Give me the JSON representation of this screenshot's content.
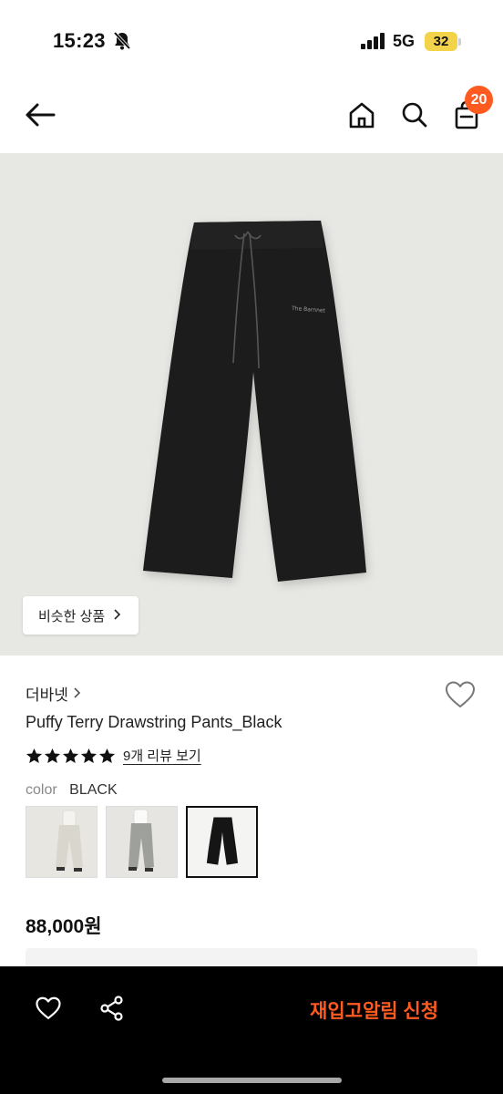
{
  "status_bar": {
    "time": "15:23",
    "network": "5G",
    "battery": "32"
  },
  "nav": {
    "cart_count": "20"
  },
  "product": {
    "similar_button": "비슷한 상품",
    "brand": "더바넷",
    "name": "Puffy Terry Drawstring Pants_Black",
    "rating": 5,
    "review_link": "9개 리뷰 보기",
    "color_label": "color",
    "color_value": "BLACK",
    "price": "88,000원",
    "swatches": [
      {
        "name": "ivory-pants-swatch",
        "selected": false
      },
      {
        "name": "grey-pants-swatch",
        "selected": false
      },
      {
        "name": "black-pants-swatch",
        "selected": true
      }
    ]
  },
  "bottom_bar": {
    "restock_button": "재입고알림 신청"
  },
  "colors": {
    "accent": "#ff5a1f",
    "battery": "#f3d34a",
    "bottom_bar": "#000000"
  }
}
